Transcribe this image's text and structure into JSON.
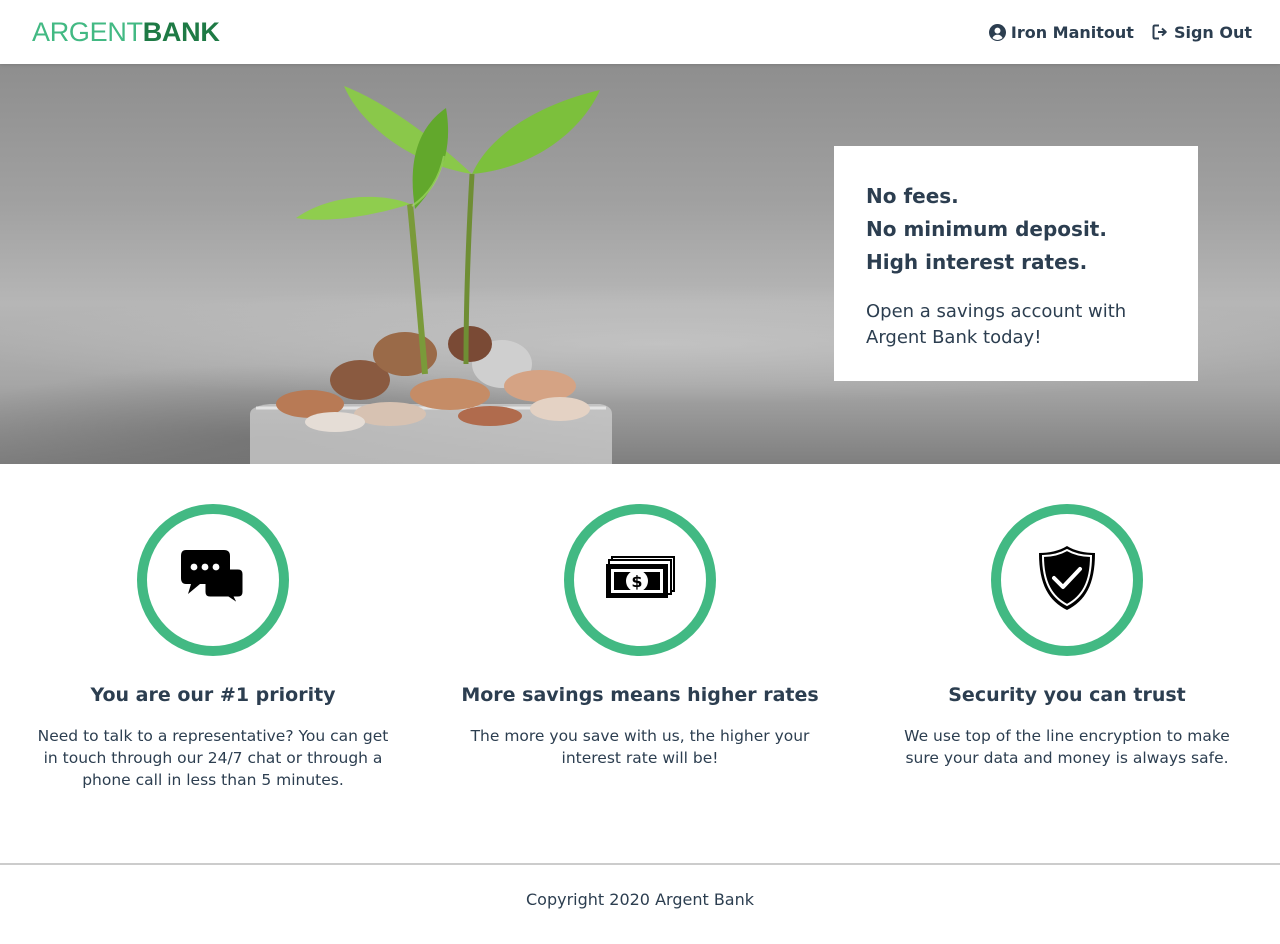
{
  "header": {
    "logo": {
      "part1": "ARGENT",
      "part2": "BANK",
      "icon": "argent-bank-logo"
    },
    "user": {
      "name": "Iron Manitout",
      "icon": "user-circle-icon"
    },
    "sign_out": {
      "label": "Sign Out",
      "icon": "sign-out-icon"
    }
  },
  "hero": {
    "subtitles": [
      "No fees.",
      "No minimum deposit.",
      "High interest rates."
    ],
    "text": "Open a savings account with Argent Bank today!"
  },
  "features": [
    {
      "icon": "chat-icon",
      "title": "You are our #1 priority",
      "text": "Need to talk to a representative? You can get in touch through our 24/7 chat or through a phone call in less than 5 minutes."
    },
    {
      "icon": "money-icon",
      "title": "More savings means higher rates",
      "text": "The more you save with us, the higher your interest rate will be!"
    },
    {
      "icon": "security-icon",
      "title": "Security you can trust",
      "text": "We use top of the line encryption to make sure your data and money is always safe."
    }
  ],
  "footer": {
    "copyright": "Copyright 2020 Argent Bank"
  },
  "colors": {
    "accent": "#42b983",
    "accent_dark": "#1e7a45",
    "text": "#2c3e50"
  }
}
